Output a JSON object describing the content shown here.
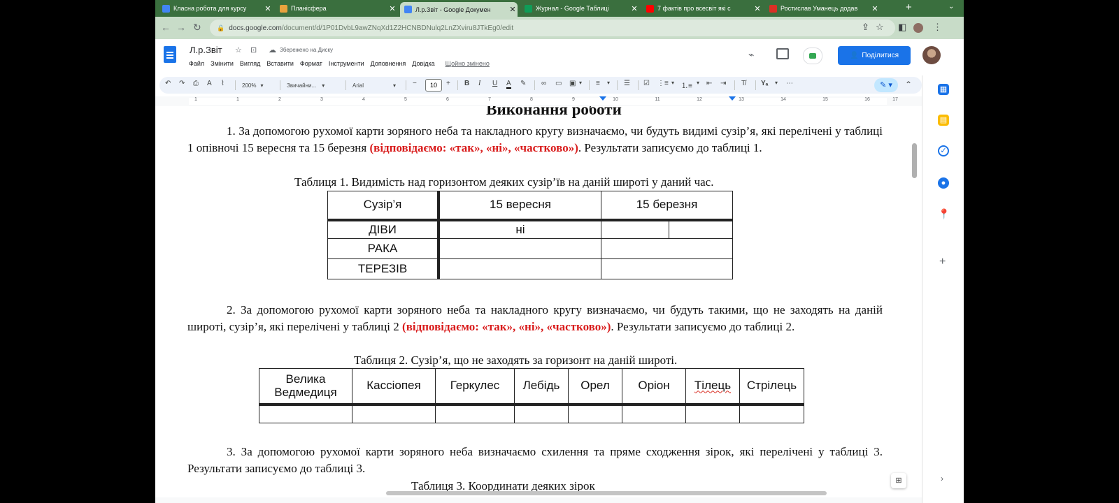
{
  "browser": {
    "tabs": [
      {
        "title": "Класна робота для курсу",
        "color": "#4285f4",
        "active": false
      },
      {
        "title": "Планісфера",
        "color": "#e8a33d",
        "active": false
      },
      {
        "title": "Л.р.Звіт - Google Докумен",
        "color": "#4285f4",
        "active": true
      },
      {
        "title": "Журнал - Google Таблиці",
        "color": "#0f9d58",
        "active": false
      },
      {
        "title": "7 фактів про всесвіт які с",
        "color": "#ff0000",
        "active": false
      },
      {
        "title": "Ростислав Уманець додав",
        "color": "#d93025",
        "active": false
      }
    ],
    "url_host": "docs.google.com",
    "url_path": "/document/d/1P01DvbL9awZNqXd1Z2HCNBDNulq2LnZXviru8JTkEg0/edit"
  },
  "docs": {
    "title": "Л.р.Звіт",
    "saved_status": "Збережено на Диску",
    "menu": [
      "Файл",
      "Змінити",
      "Вигляд",
      "Вставити",
      "Формат",
      "Інструменти",
      "Доповнення",
      "Довідка"
    ],
    "last_edit": "Щойно змінено",
    "share_label": "Поділитися",
    "toolbar": {
      "zoom": "200%",
      "style": "Звичайни...",
      "font": "Arial",
      "font_size": "10"
    },
    "ruler": [
      "1",
      "1",
      "2",
      "3",
      "4",
      "5",
      "6",
      "7",
      "8",
      "9",
      "10",
      "11",
      "12",
      "13",
      "14",
      "15",
      "16",
      "17",
      "18"
    ]
  },
  "document": {
    "heading": "Виконання роботи",
    "p1": {
      "text": "1. За допомогою рухомої карти зоряного неба та накладного кругу визначаємо, чи будуть видимі сузір’я, які перелічені у таблиці 1 опівночі 15 вересня та 15 березня ",
      "red": "(відповідаємо: «так», «ні», «частково»)",
      "tail": ". Результати записуємо до таблиці 1."
    },
    "table1": {
      "caption": "Таблиця 1. Видимість над горизонтом деяких сузір’їв на даній широті у даний час.",
      "headers": [
        "Сузір’я",
        "15 вересня",
        "15 березня"
      ],
      "rows": [
        [
          "ДІВИ",
          "ні",
          ""
        ],
        [
          "РАКА",
          "",
          ""
        ],
        [
          "ТЕРЕЗІВ",
          "",
          ""
        ]
      ]
    },
    "p2": {
      "text": "2. За допомогою рухомої карти зоряного неба та накладного кругу визначаємо, чи будуть такими, що не заходять на даній широті, сузір’я, які перелічені у таблиці 2 ",
      "red": "(відповідаємо: «так», «ні», «частково»)",
      "tail": ". Результати записуємо до таблиці 2."
    },
    "table2": {
      "caption": "Таблиця 2. Сузір’я, що не заходять за горизонт на даній широті.",
      "headers": [
        "Велика Ведмедиця",
        "Кассіопея",
        "Геркулес",
        "Лебідь",
        "Орел",
        "Оріон",
        "Тілець",
        "Стрілець"
      ]
    },
    "p3": {
      "text": "3. За допомогою рухомої карти зоряного неба визначаємо схилення та пряме сходження зірок, які перелічені у таблиці 3. Результати записуємо до таблиці 3."
    },
    "table3_caption_partial": "Таблиця 3. Координати деяких зірок"
  }
}
